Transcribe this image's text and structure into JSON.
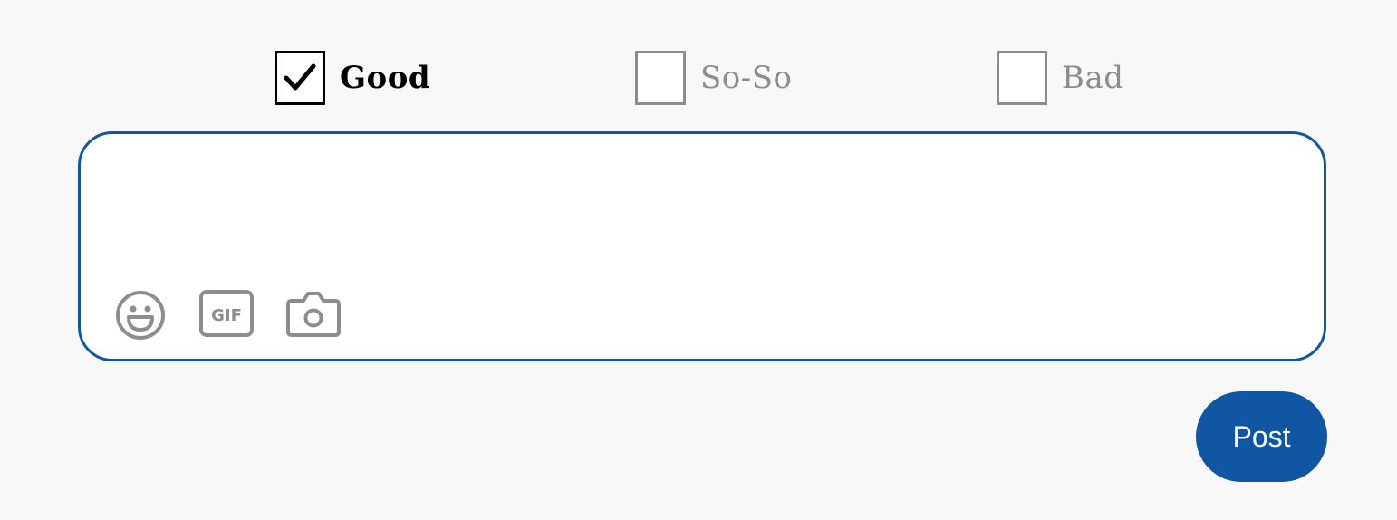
{
  "rating": {
    "options": [
      {
        "label": "Good",
        "checked": true
      },
      {
        "label": "So-So",
        "checked": false
      },
      {
        "label": "Bad",
        "checked": false
      }
    ]
  },
  "composer": {
    "value": "",
    "tools": [
      {
        "icon": "emoji-icon"
      },
      {
        "icon": "gif-icon",
        "text": "GIF"
      },
      {
        "icon": "camera-icon"
      }
    ]
  },
  "actions": {
    "post_label": "Post"
  },
  "colors": {
    "accent": "#1156a3",
    "muted": "#8d8d8d",
    "background": "#f8f8f8"
  }
}
